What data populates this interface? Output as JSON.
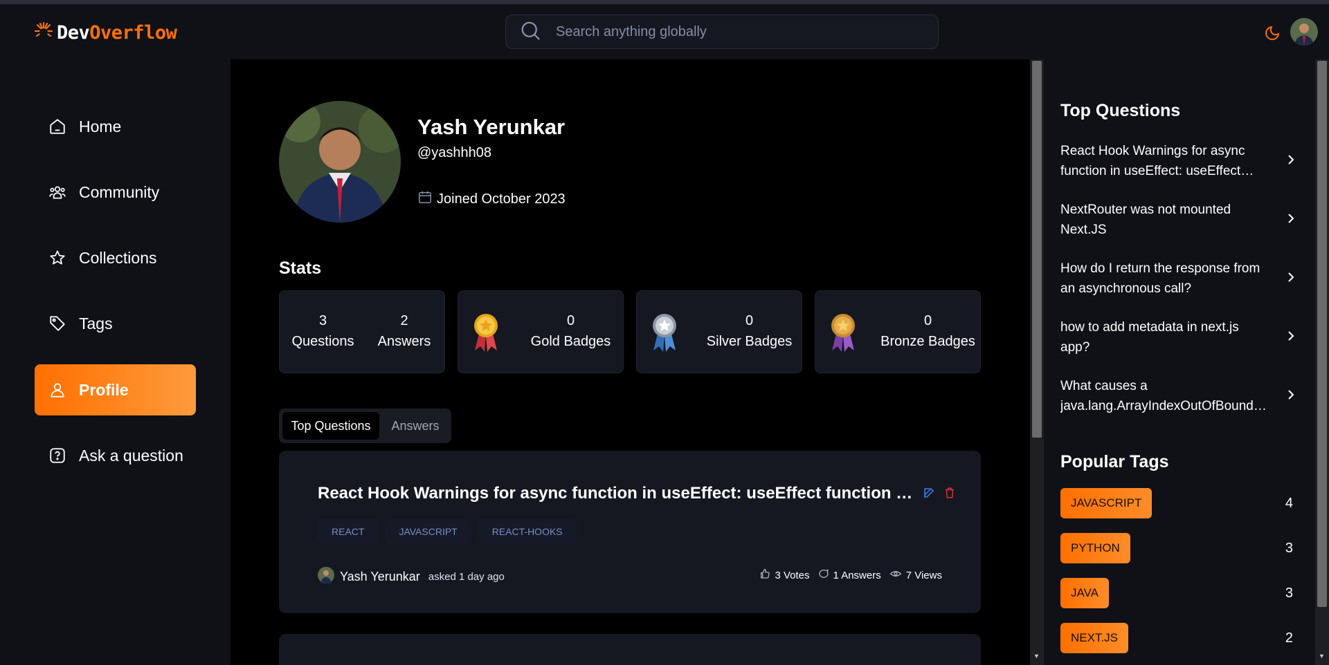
{
  "navbar": {
    "logo_part1": "Dev",
    "logo_part2": "Overflow",
    "search_placeholder": "Search anything globally"
  },
  "sidebar": {
    "items": [
      {
        "label": "Home",
        "icon": "home-icon"
      },
      {
        "label": "Community",
        "icon": "users-icon"
      },
      {
        "label": "Collections",
        "icon": "star-icon"
      },
      {
        "label": "Tags",
        "icon": "tag-icon"
      },
      {
        "label": "Profile",
        "icon": "user-icon",
        "active": true
      },
      {
        "label": "Ask a question",
        "icon": "question-icon"
      }
    ]
  },
  "profile": {
    "name": "Yash Yerunkar",
    "username": "@yashhh08",
    "joined": "Joined October 2023"
  },
  "stats": {
    "title": "Stats",
    "questions_count": "3",
    "questions_label": "Questions",
    "answers_count": "2",
    "answers_label": "Answers",
    "gold_count": "0",
    "gold_label": "Gold Badges",
    "silver_count": "0",
    "silver_label": "Silver Badges",
    "bronze_count": "0",
    "bronze_label": "Bronze Badges"
  },
  "tabs": {
    "top_questions": "Top Questions",
    "answers": "Answers"
  },
  "question": {
    "title": "React Hook Warnings for async function in useEffect: useEffect function must return a cleanup function or nothing",
    "tags": [
      "react",
      "javascript",
      "react-hooks"
    ],
    "author": "Yash Yerunkar",
    "asked": "asked 1 day ago",
    "votes": "3 Votes",
    "answers": "1 Answers",
    "views": "7 Views"
  },
  "right": {
    "top_questions_title": "Top Questions",
    "top_questions": [
      "React Hook Warnings for async function in useEffect: useEffect function must return a cleanup function or nothing",
      "NextRouter was not mounted Next.JS",
      "How do I return the response from an asynchronous call?",
      "how to add metadata in next.js app?",
      "What causes a java.lang.ArrayIndexOutOfBoundsException and how do I prevent it?"
    ],
    "popular_tags_title": "Popular Tags",
    "popular_tags": [
      {
        "name": "javascript",
        "count": "4"
      },
      {
        "name": "python",
        "count": "3"
      },
      {
        "name": "java",
        "count": "3"
      },
      {
        "name": "next.js",
        "count": "2"
      }
    ]
  },
  "colors": {
    "accent": "#ff7000",
    "background": "#000000",
    "panel": "#0f1117",
    "card": "#151821",
    "tag_text": "#7b8ec8"
  }
}
